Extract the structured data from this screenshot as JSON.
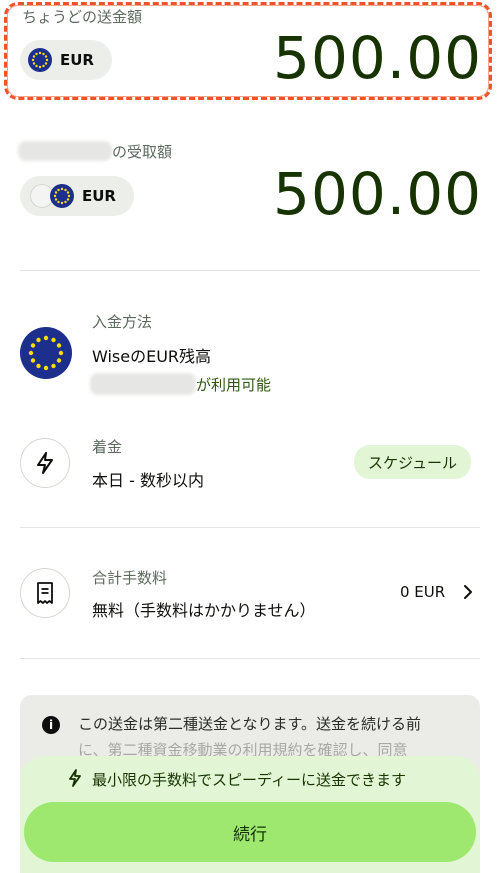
{
  "send": {
    "label": "ちょうどの送金額",
    "currency": "EUR",
    "amount": "500.00"
  },
  "receive": {
    "label_suffix": "の受取額",
    "currency": "EUR",
    "amount": "500.00"
  },
  "payment_method": {
    "label": "入金方法",
    "value": "WiseのEUR残高",
    "available_suffix": "が利用可能"
  },
  "arrival": {
    "label": "着金",
    "value": "本日 - 数秒以内",
    "schedule_button": "スケジュール"
  },
  "fees": {
    "label": "合計手数料",
    "value": "無料（手数料はかかりません）",
    "amount": "0 EUR"
  },
  "notice": {
    "line1": "この送金は第二種送金となります。送金を続ける前",
    "line2": "に、第二種資金移動業の利用規約を確認し、同意"
  },
  "promo": {
    "text": "最小限の手数料でスピーディーに送金できます"
  },
  "continue_button": "続行",
  "colors": {
    "accent": "#9fe870",
    "dark_green": "#163300",
    "highlight": "#f0532a"
  }
}
